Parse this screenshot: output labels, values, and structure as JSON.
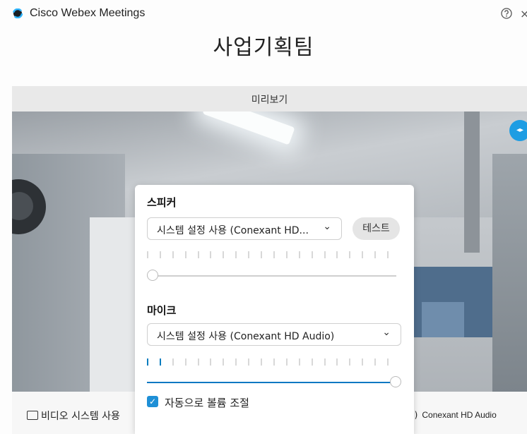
{
  "window": {
    "app_title": "Cisco Webex Meetings",
    "help_icon": "help-circle-icon",
    "close_glyph": "×"
  },
  "meeting": {
    "title": "사업기획팀"
  },
  "preview": {
    "label": "미리보기"
  },
  "speaker": {
    "heading": "스피커",
    "device": "시스템 설정 사용 (Conexant HD...",
    "test_label": "테스트",
    "level": 0,
    "volume": 0
  },
  "microphone": {
    "heading": "마이크",
    "device": "시스템 설정 사용 (Conexant HD Audio)",
    "level_ticks_active": 2,
    "volume": 1.0
  },
  "auto_volume": {
    "label": "자동으로 볼륨 조절",
    "checked": true
  },
  "bottom": {
    "video_system": "비디오 시스템 사용",
    "audio_device": "Conexant HD Audio"
  },
  "colors": {
    "accent": "#1e9de3",
    "slider_fill": "#0a78c2"
  }
}
